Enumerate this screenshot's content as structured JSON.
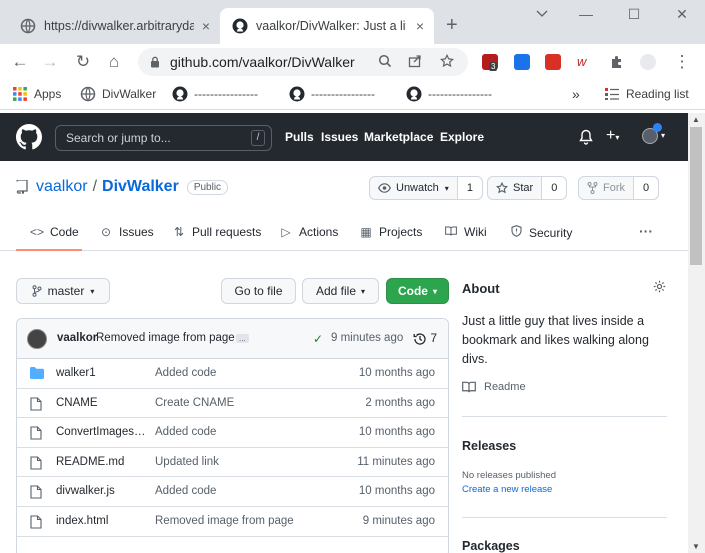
{
  "browser": {
    "tabs": [
      {
        "title": "https://divwalker.arbitraryda",
        "close": "×"
      },
      {
        "title": "vaalkor/DivWalker: Just a little",
        "close": "×"
      }
    ],
    "new_tab": "+",
    "window_controls": {
      "minimize": "—",
      "maximize": "☐",
      "close": "✕"
    },
    "nav": {
      "back": "←",
      "forward": "→",
      "reload": "↻",
      "home": "⌂"
    },
    "url": "github.com/vaalkor/DivWalker",
    "extension_badge": "3",
    "menu": "⋮",
    "bookmarks": [
      {
        "label": "Apps",
        "icon": "apps-grid-icon"
      },
      {
        "label": "DivWalker",
        "icon": "globe-icon"
      },
      {
        "label": "----------------",
        "icon": "github-icon"
      },
      {
        "label": "----------------",
        "icon": "github-icon"
      },
      {
        "label": "----------------",
        "icon": "github-icon"
      }
    ],
    "bookmarks_more": "»",
    "reading_list": "Reading list"
  },
  "github_header": {
    "search_placeholder": "Search or jump to...",
    "search_shortcut": "/",
    "nav": [
      "Pulls",
      "Issues",
      "Marketplace",
      "Explore"
    ]
  },
  "repo": {
    "owner": "vaalkor",
    "separator": "/",
    "name": "DivWalker",
    "visibility": "Public",
    "watch": {
      "label": "Unwatch",
      "count": "1"
    },
    "star": {
      "label": "Star",
      "count": "0"
    },
    "fork": {
      "label": "Fork",
      "count": "0"
    },
    "tabs": [
      {
        "label": "Code",
        "icon": "code-icon",
        "glyph": "<>"
      },
      {
        "label": "Issues",
        "icon": "issue-icon",
        "glyph": "⊙"
      },
      {
        "label": "Pull requests",
        "icon": "pull-request-icon",
        "glyph": "⇅"
      },
      {
        "label": "Actions",
        "icon": "play-icon",
        "glyph": "▷"
      },
      {
        "label": "Projects",
        "icon": "project-icon",
        "glyph": "▦"
      },
      {
        "label": "Wiki",
        "icon": "book-icon",
        "glyph": "📖"
      },
      {
        "label": "Security",
        "icon": "shield-icon",
        "glyph": "⛉"
      }
    ],
    "tabs_more": "···"
  },
  "branch_bar": {
    "branch": "master",
    "go_to_file": "Go to file",
    "add_file": "Add file",
    "code": "Code"
  },
  "latest_commit": {
    "author": "vaalkor",
    "message": "Removed image from page",
    "ellipsis": "...",
    "check": "✓",
    "time": "9 minutes ago",
    "commit_count": "7"
  },
  "files": [
    {
      "type": "folder",
      "name": "walker1",
      "message": "Added code",
      "age": "10 months ago"
    },
    {
      "type": "file",
      "name": "CNAME",
      "message": "Create CNAME",
      "age": "2 months ago"
    },
    {
      "type": "file",
      "name": "ConvertImages....",
      "message": "Added code",
      "age": "10 months ago"
    },
    {
      "type": "file",
      "name": "README.md",
      "message": "Updated link",
      "age": "11 minutes ago"
    },
    {
      "type": "file",
      "name": "divwalker.js",
      "message": "Added code",
      "age": "10 months ago"
    },
    {
      "type": "file",
      "name": "index.html",
      "message": "Removed image from page",
      "age": "9 minutes ago"
    }
  ],
  "about": {
    "heading": "About",
    "description": "Just a little guy that lives inside a bookmark and likes walking along divs.",
    "readme": "Readme",
    "releases_heading": "Releases",
    "no_releases": "No releases published",
    "create_release": "Create a new release",
    "packages_heading": "Packages"
  },
  "colors": {
    "header_bg": "#24292f",
    "link": "#0969da",
    "green_button": "#2da44e",
    "tab_underline": "#fd8c73"
  }
}
